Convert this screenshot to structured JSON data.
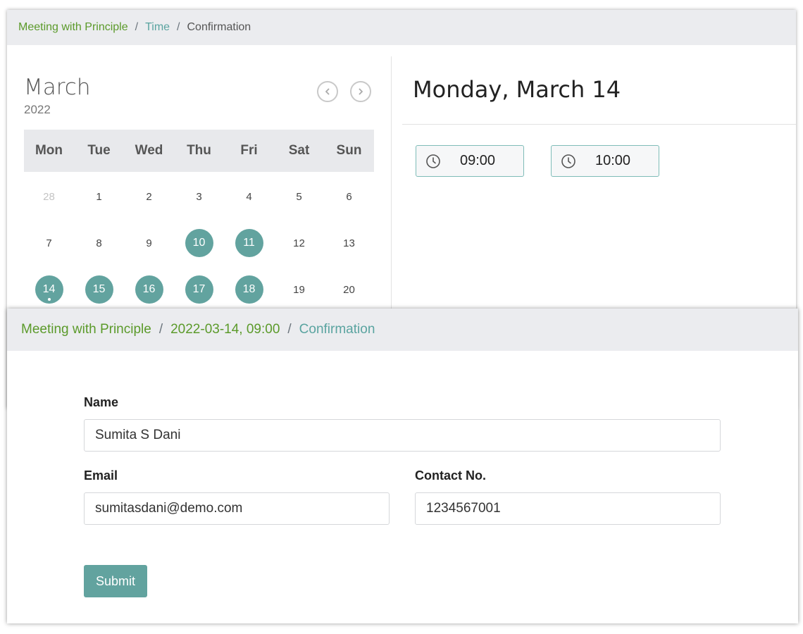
{
  "calendar_step": {
    "breadcrumb": {
      "meeting": "Meeting with Principle",
      "time": "Time",
      "confirmation": "Confirmation",
      "separator": "/"
    },
    "month": "March",
    "year": "2022",
    "weekdays": [
      "Mon",
      "Tue",
      "Wed",
      "Thu",
      "Fri",
      "Sat",
      "Sun"
    ],
    "days": [
      {
        "label": "28",
        "state": "muted"
      },
      {
        "label": "1",
        "state": "normal"
      },
      {
        "label": "2",
        "state": "normal"
      },
      {
        "label": "3",
        "state": "normal"
      },
      {
        "label": "4",
        "state": "normal"
      },
      {
        "label": "5",
        "state": "normal"
      },
      {
        "label": "6",
        "state": "normal"
      },
      {
        "label": "7",
        "state": "normal"
      },
      {
        "label": "8",
        "state": "normal"
      },
      {
        "label": "9",
        "state": "normal"
      },
      {
        "label": "10",
        "state": "available"
      },
      {
        "label": "11",
        "state": "available"
      },
      {
        "label": "12",
        "state": "normal"
      },
      {
        "label": "13",
        "state": "normal"
      },
      {
        "label": "14",
        "state": "selected"
      },
      {
        "label": "15",
        "state": "available"
      },
      {
        "label": "16",
        "state": "available"
      },
      {
        "label": "17",
        "state": "available"
      },
      {
        "label": "18",
        "state": "available"
      },
      {
        "label": "19",
        "state": "normal"
      },
      {
        "label": "20",
        "state": "normal"
      }
    ],
    "selected_date_heading": "Monday, March 14",
    "time_slots": [
      "09:00",
      "10:00"
    ],
    "icons": {
      "prev": "chevron-left-icon",
      "next": "chevron-right-icon",
      "slot": "clock-icon"
    }
  },
  "confirmation_step": {
    "breadcrumb": {
      "meeting": "Meeting with Principle",
      "datetime": "2022-03-14, 09:00",
      "confirmation": "Confirmation",
      "separator": "/"
    },
    "form": {
      "name_label": "Name",
      "name_value": "Sumita S Dani",
      "email_label": "Email",
      "email_value": "sumitasdani@demo.com",
      "phone_label": "Contact No.",
      "phone_value": "1234567001",
      "submit_label": "Submit"
    }
  },
  "colors": {
    "accent": "#62a39f",
    "breadcrumb_green": "#5b9a2a",
    "breadcrumb_teal": "#5aa4a0",
    "bar_bg": "#ebecef"
  }
}
